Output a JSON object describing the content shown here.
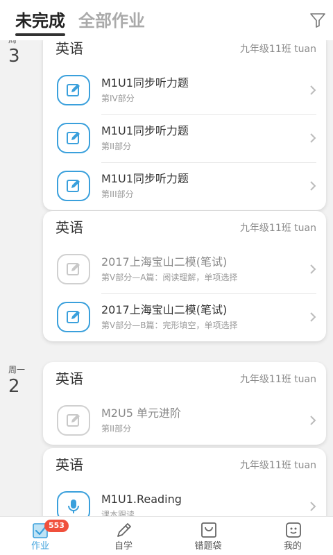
{
  "header": {
    "tab_active": "未完成",
    "tab_inactive": "全部作业"
  },
  "groups": [
    {
      "week": "周一",
      "day": "3",
      "cards": [
        {
          "subject": "英语",
          "class": "九年级11班 tuan",
          "items": [
            {
              "title": "M1U1同步听力题",
              "sub": "第IV部分",
              "icon": "edit-icon",
              "state": "active"
            },
            {
              "title": "M1U1同步听力题",
              "sub": "第II部分",
              "icon": "edit-icon",
              "state": "active"
            },
            {
              "title": "M1U1同步听力题",
              "sub": "第III部分",
              "icon": "edit-icon",
              "state": "active"
            }
          ]
        },
        {
          "subject": "英语",
          "class": "九年级11班 tuan",
          "items": [
            {
              "title": "2017上海宝山二模(笔试)",
              "sub": "第V部分—A篇：阅读理解，单项选择",
              "icon": "edit-icon",
              "state": "disabled"
            },
            {
              "title": "2017上海宝山二模(笔试)",
              "sub": "第V部分—B篇：完形填空，单项选择",
              "icon": "edit-icon",
              "state": "active"
            }
          ]
        }
      ]
    },
    {
      "week": "周一",
      "day": "2",
      "cards": [
        {
          "subject": "英语",
          "class": "九年级11班 tuan",
          "items": [
            {
              "title": "M2U5 单元进阶",
              "sub": "第II部分",
              "icon": "edit-icon",
              "state": "disabled"
            }
          ]
        },
        {
          "subject": "英语",
          "class": "九年级11班 tuan",
          "items": [
            {
              "title": "M1U1.Reading",
              "sub": "课本跟读",
              "icon": "microphone-icon",
              "state": "active"
            }
          ]
        }
      ]
    }
  ],
  "tabbar": {
    "items": [
      {
        "label": "作业",
        "icon": "homework-icon",
        "active": true,
        "badge": "553"
      },
      {
        "label": "自学",
        "icon": "pencil-icon",
        "active": false
      },
      {
        "label": "错题袋",
        "icon": "bag-icon",
        "active": false
      },
      {
        "label": "我的",
        "icon": "profile-icon",
        "active": false
      }
    ]
  },
  "colors": {
    "accent": "#3aa0dc",
    "badge": "#f0503c",
    "disabled": "#d0d0d0"
  }
}
